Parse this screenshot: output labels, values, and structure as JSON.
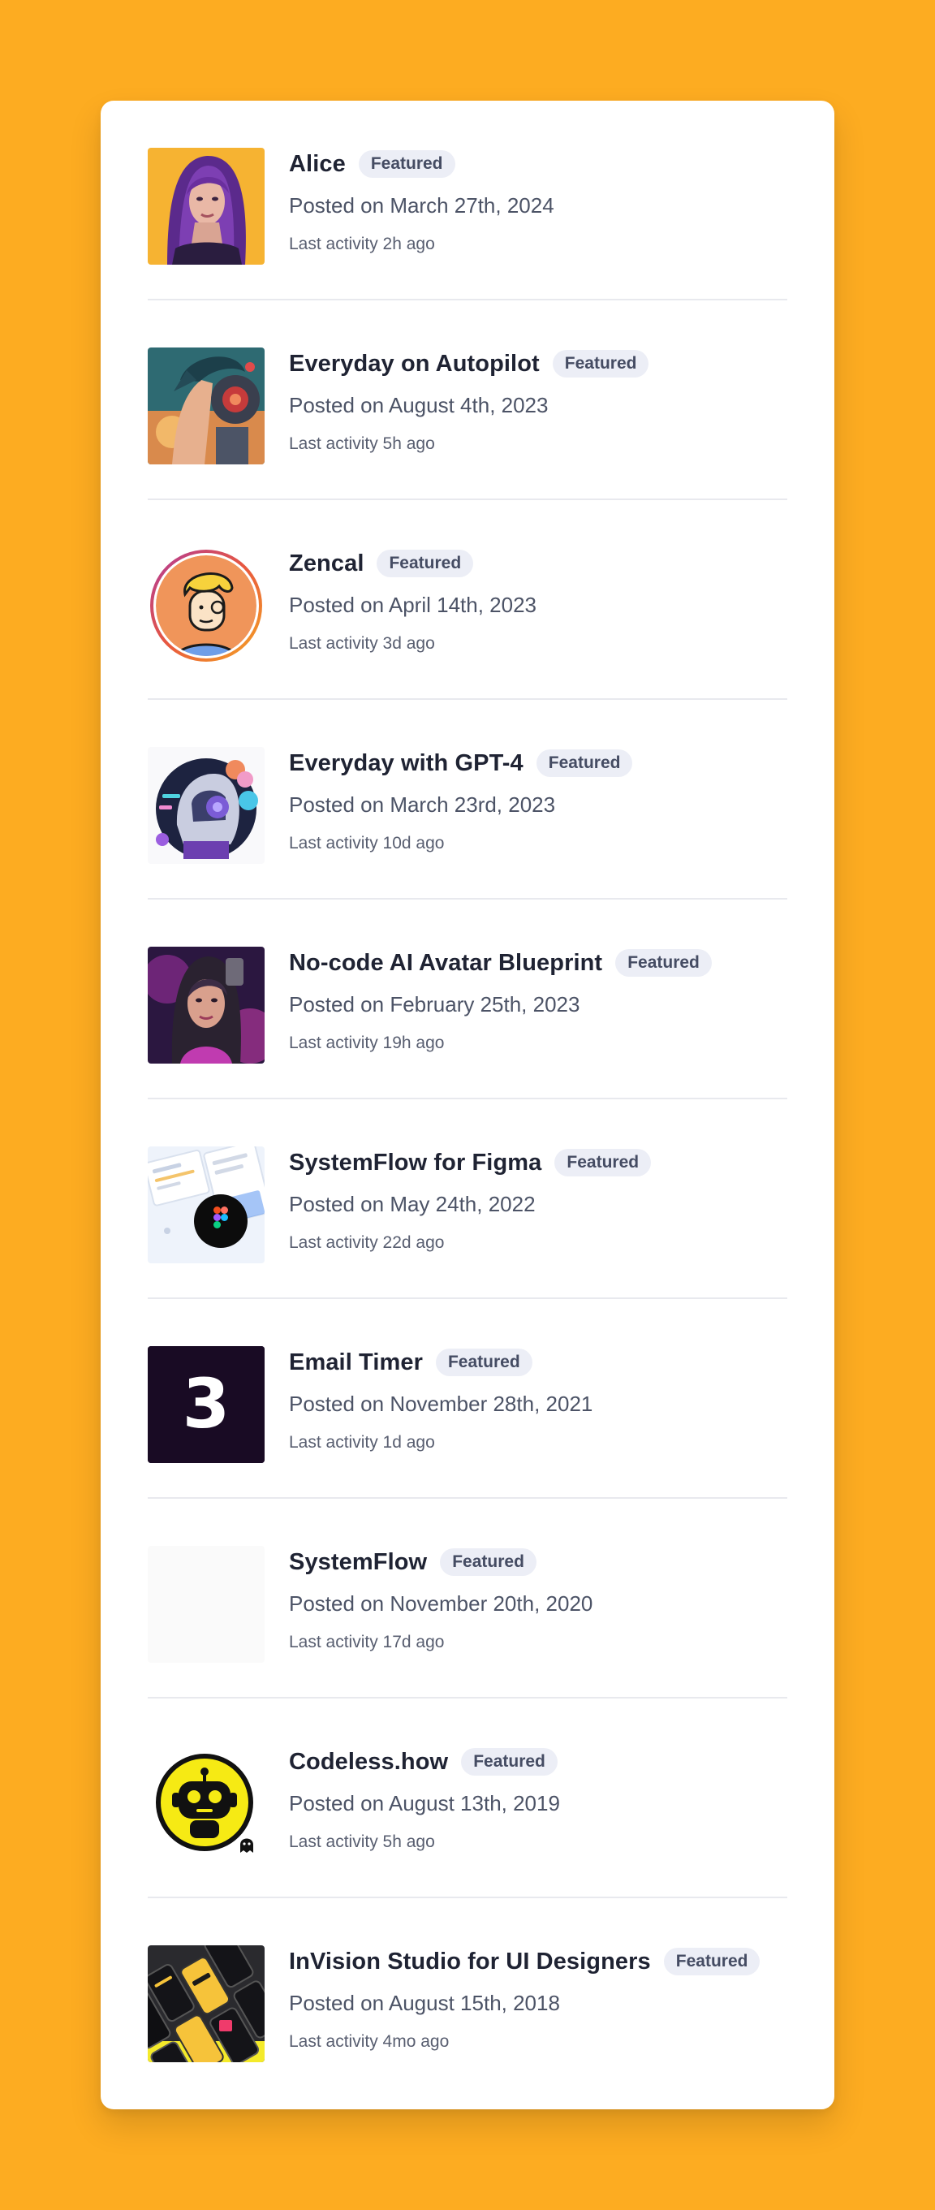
{
  "items": [
    {
      "title": "Alice",
      "badge": "Featured",
      "posted": "Posted on March 27th, 2024",
      "activity": "Last activity 2h ago",
      "avatar": "purple-haired-woman-portrait"
    },
    {
      "title": "Everyday on Autopilot",
      "badge": "Featured",
      "posted": "Posted on August 4th, 2023",
      "activity": "Last activity 5h ago",
      "avatar": "cyborg-profile-illustration"
    },
    {
      "title": "Zencal",
      "badge": "Featured",
      "posted": "Posted on April 14th, 2023",
      "activity": "Last activity 3d ago",
      "avatar": "cartoon-face-avatar"
    },
    {
      "title": "Everyday with GPT-4",
      "badge": "Featured",
      "posted": "Posted on March 23rd, 2023",
      "activity": "Last activity 10d ago",
      "avatar": "robot-head-illustration"
    },
    {
      "title": "No-code AI Avatar Blueprint",
      "badge": "Featured",
      "posted": "Posted on February 25th, 2023",
      "activity": "Last activity 19h ago",
      "avatar": "cyberpunk-woman-portrait"
    },
    {
      "title": "SystemFlow for Figma",
      "badge": "Featured",
      "posted": "Posted on May 24th, 2022",
      "activity": "Last activity 22d ago",
      "avatar": "figma-logo-mockup"
    },
    {
      "title": "Email Timer",
      "badge": "Featured",
      "posted": "Posted on November 28th, 2021",
      "activity": "Last activity 1d ago",
      "avatar": "number-3-logo",
      "avatar_text": "3"
    },
    {
      "title": "SystemFlow",
      "badge": "Featured",
      "posted": "Posted on November 20th, 2020",
      "activity": "Last activity 17d ago",
      "avatar": "blank-placeholder"
    },
    {
      "title": "Codeless.how",
      "badge": "Featured",
      "posted": "Posted on August 13th, 2019",
      "activity": "Last activity 5h ago",
      "avatar": "robot-logo"
    },
    {
      "title": "InVision Studio for UI Designers",
      "badge": "Featured",
      "posted": "Posted on August 15th, 2018",
      "activity": "Last activity 4mo ago",
      "avatar": "phone-screens-mockup"
    }
  ],
  "colors": {
    "background": "#FDAC21",
    "card": "#FFFFFF",
    "badge_bg": "#ECEEF6",
    "title": "#1F2333",
    "text": "#4C5366"
  }
}
